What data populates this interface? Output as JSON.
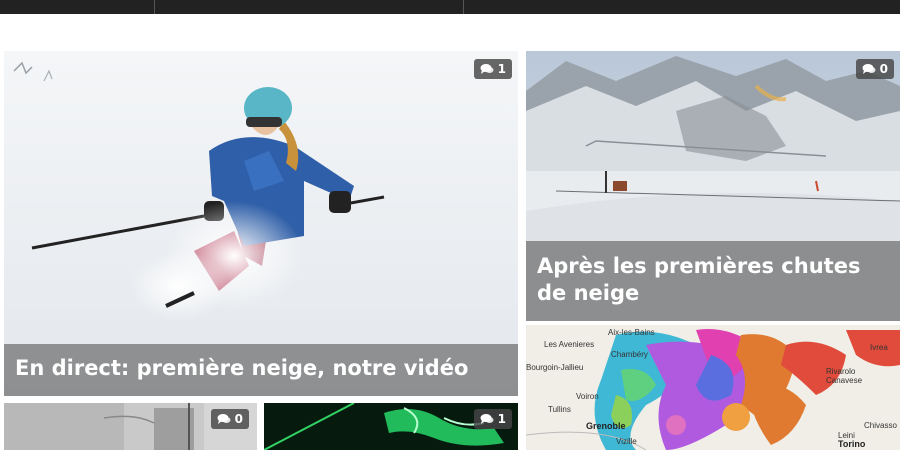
{
  "header": {
    "background": "#222222"
  },
  "articles": [
    {
      "title": "En direct: première neige, notre vidéo",
      "comments": "1",
      "image": "skier-in-powder-snow-photo"
    },
    {
      "title": "Après les premières chutes de neige",
      "comments": "0",
      "image": "snowy-ski-slope-landscape-photo"
    },
    {
      "title": "",
      "comments": "",
      "image": "snowfall-map-alps-photo",
      "map_labels": [
        "Aix-les-Bains",
        "Les Avenieres",
        "Chambéry",
        "Bourgoin-Jallieu",
        "Voiron",
        "Tullins",
        "Grenoble",
        "Rivarolo Canavese",
        "Ivrea",
        "Chivasso",
        "Leini",
        "Torino",
        "Vizille"
      ]
    },
    {
      "title": "",
      "comments": "0",
      "image": "snowy-foggy-street-photo"
    },
    {
      "title": "",
      "comments": "1",
      "image": "green-laser-light-photo"
    }
  ],
  "icons": {
    "comment": "comments-icon"
  },
  "colors": {
    "badge_bg": "#464646",
    "caption_bg": "#6e6e6e",
    "text": "#ffffff"
  }
}
